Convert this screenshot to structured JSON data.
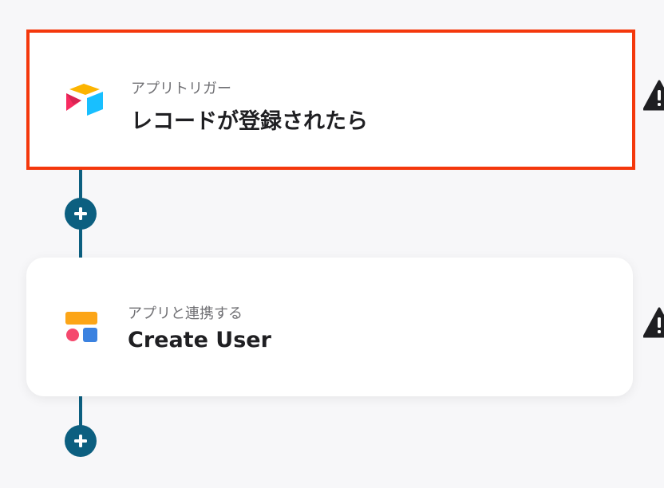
{
  "flow": {
    "steps": [
      {
        "type_label": "アプリトリガー",
        "title": "レコードが登録されたら",
        "app_icon": "airtable-icon",
        "selected": true,
        "status_icon": "warning-icon"
      },
      {
        "type_label": "アプリと連携する",
        "title": "Create User",
        "app_icon": "app-blocks-icon",
        "selected": false,
        "status_icon": "warning-icon"
      }
    ],
    "add_step_icon": "plus-icon"
  },
  "colors": {
    "connector": "#0c5f80",
    "selected_border": "#f4380c",
    "card_background": "#ffffff",
    "page_background": "#f7f7f9",
    "warning": "#1f1f22"
  }
}
